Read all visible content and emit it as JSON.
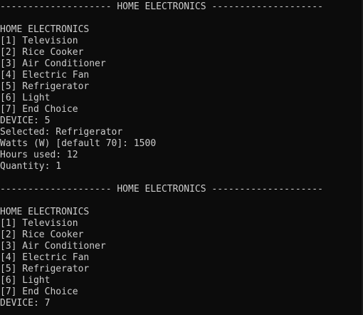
{
  "console": {
    "lines": [
      "-------------------- HOME ELECTRONICS --------------------",
      "",
      "HOME ELECTRONICS",
      "[1] Television",
      "[2] Rice Cooker",
      "[3] Air Conditioner",
      "[4] Electric Fan",
      "[5] Refrigerator",
      "[6] Light",
      "[7] End Choice",
      "DEVICE: 5",
      "Selected: Refrigerator",
      "Watts (W) [default 70]: 1500",
      "Hours used: 12",
      "Quantity: 1",
      "",
      "-------------------- HOME ELECTRONICS --------------------",
      "",
      "HOME ELECTRONICS",
      "[1] Television",
      "[2] Rice Cooker",
      "[3] Air Conditioner",
      "[4] Electric Fan",
      "[5] Refrigerator",
      "[6] Light",
      "[7] End Choice",
      "DEVICE: 7"
    ]
  },
  "colors": {
    "background": "#0c0c0c",
    "text": "#cccccc"
  }
}
